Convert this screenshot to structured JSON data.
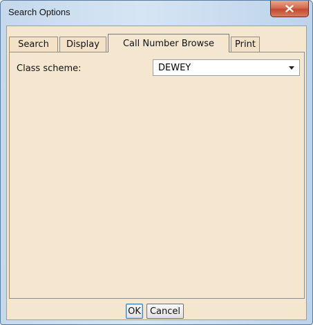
{
  "window": {
    "title": "Search Options",
    "close_icon": "close-icon"
  },
  "tabs": [
    {
      "label": "Search",
      "active": false
    },
    {
      "label": "Display",
      "active": false
    },
    {
      "label": "Call Number Browse",
      "active": true
    },
    {
      "label": "Print",
      "active": false
    }
  ],
  "call_number_browse": {
    "class_scheme_label": "Class scheme:",
    "class_scheme_value": "DEWEY",
    "dropdown_icon": "chevron-down-icon"
  },
  "buttons": {
    "ok_label": "OK",
    "cancel_label": "Cancel"
  },
  "colors": {
    "panel_background": "#f5e7cf",
    "close_button": "#c24a2f",
    "title_bar": "#c5d9ec"
  }
}
